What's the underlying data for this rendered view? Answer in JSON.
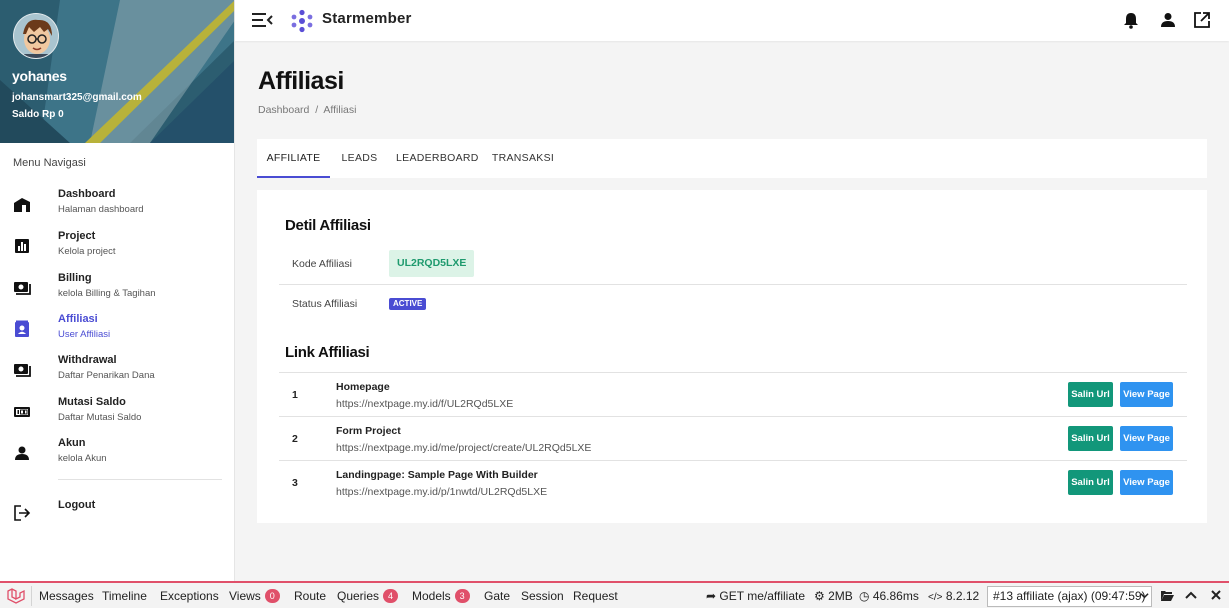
{
  "profile": {
    "name": "yohanes",
    "email": "johansmart325@gmail.com",
    "saldo": "Saldo Rp 0"
  },
  "sidebar": {
    "menu_title": "Menu Navigasi",
    "items": [
      {
        "label": "Dashboard",
        "sub": "Halaman dashboard",
        "icon": "home-icon"
      },
      {
        "label": "Project",
        "sub": "Kelola project",
        "icon": "bar-chart-icon"
      },
      {
        "label": "Billing",
        "sub": "kelola Billing & Tagihan",
        "icon": "cash-icon"
      },
      {
        "label": "Affiliasi",
        "sub": "User Affiliasi",
        "icon": "contact-card-icon"
      },
      {
        "label": "Withdrawal",
        "sub": "Daftar Penarikan Dana",
        "icon": "cash-icon"
      },
      {
        "label": "Mutasi Saldo",
        "sub": "Daftar Mutasi Saldo",
        "icon": "counter-icon"
      },
      {
        "label": "Akun",
        "sub": "kelola Akun",
        "icon": "person-icon"
      }
    ],
    "logout": "Logout"
  },
  "topbar": {
    "brand": "Starmember"
  },
  "page": {
    "title": "Affiliasi",
    "breadcrumb": [
      "Dashboard",
      "Affiliasi"
    ],
    "breadcrumb_sep": "/"
  },
  "tabs": [
    "AFFILIATE",
    "LEADS",
    "LEADERBOARD",
    "TRANSAKSI"
  ],
  "detail": {
    "title": "Detil Affiliasi",
    "kode_label": "Kode Affiliasi",
    "kode_value": "UL2RQD5LXE",
    "status_label": "Status Affiliasi",
    "status_value": "ACTIVE"
  },
  "links": {
    "title": "Link Affiliasi",
    "copy_label": "Salin Url",
    "view_label": "View Page",
    "rows": [
      {
        "num": "1",
        "name": "Homepage",
        "url": "https://nextpage.my.id/f/UL2RQd5LXE"
      },
      {
        "num": "2",
        "name": "Form Project",
        "url": "https://nextpage.my.id/me/project/create/UL2RQd5LXE"
      },
      {
        "num": "3",
        "name": "Landingpage: Sample Page With Builder",
        "url": "https://nextpage.my.id/p/1nwtd/UL2RQd5LXE"
      }
    ]
  },
  "debugbar": {
    "tabs": [
      {
        "label": "Messages"
      },
      {
        "label": "Timeline"
      },
      {
        "label": "Exceptions"
      },
      {
        "label": "Views",
        "badge": "0"
      },
      {
        "label": "Route"
      },
      {
        "label": "Queries",
        "badge": "4"
      },
      {
        "label": "Models",
        "badge": "3"
      },
      {
        "label": "Gate"
      },
      {
        "label": "Session"
      },
      {
        "label": "Request"
      }
    ],
    "route": "GET me/affiliate",
    "memory": "2MB",
    "time": "46.86ms",
    "php_version": "8.2.12",
    "request_select": "#13 affiliate (ajax) (09:47:59)"
  },
  "colors": {
    "accent": "#4a4cd3",
    "success_bg": "#dcf3e7",
    "success_text": "#1e9a6e",
    "copy_button": "#12977a",
    "view_button": "#2f93f0",
    "debug_accent": "#e0506a"
  }
}
